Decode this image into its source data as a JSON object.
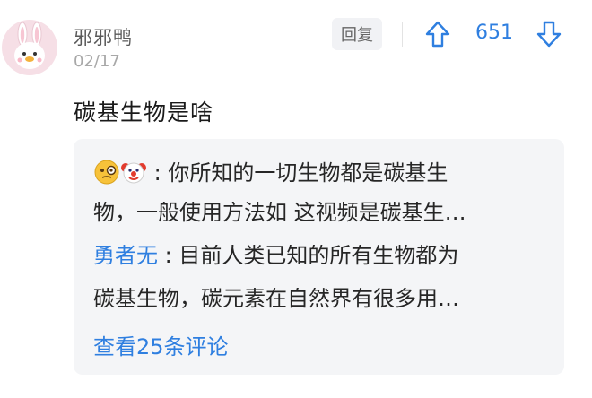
{
  "comment": {
    "username": "邪邪鸭",
    "date": "02/17",
    "reply_label": "回复",
    "vote_count": "651",
    "text": "碳基生物是啥"
  },
  "replies": [
    {
      "name_icons": [
        "monocle-face-emoji",
        "clown-face-emoji"
      ],
      "separator": ":",
      "line1": "你所知的一切生物都是碳基生",
      "line2": "物，一般使用方法如 这视频是碳基生…"
    },
    {
      "name": "勇者无",
      "separator": ":",
      "line1": "目前人类已知的所有生物都为",
      "line2": "碳基生物，碳元素在自然界有很多用…"
    }
  ],
  "more_replies_label": "查看25条评论",
  "colors": {
    "accent": "#2f7fe0",
    "subbox_bg": "#f4f5f7"
  }
}
